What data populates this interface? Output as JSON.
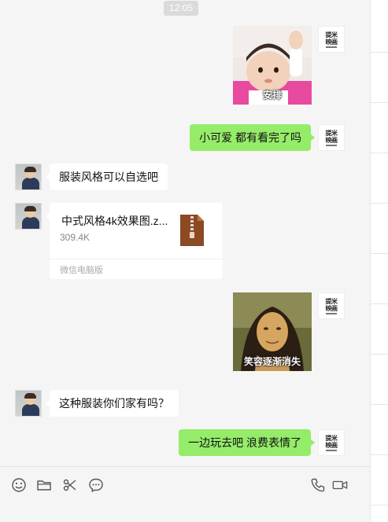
{
  "time_divider": "12:05",
  "brand_avatar": {
    "line1": "提米",
    "line2": "映画"
  },
  "messages": {
    "sticker1_caption": "安排",
    "msg1": "小可爱 都有看完了吗",
    "msg2": "服装风格可以自选吧",
    "file": {
      "name": "中式风格4k效果图.z...",
      "size": "309.4K",
      "source": "微信电脑版",
      "icon": "zip-file-icon"
    },
    "sticker2_caption": "笑容逐渐消失",
    "msg3": "这种服装你们家有吗？",
    "msg4": "一边玩去吧  浪费表情了"
  },
  "toolbar": {
    "icons": [
      "emoji-icon",
      "folder-icon",
      "scissors-icon",
      "chat-history-icon",
      "phone-icon",
      "video-call-icon"
    ]
  },
  "colors": {
    "self_bubble": "#95ec69",
    "other_bubble": "#ffffff",
    "background": "#f5f5f5",
    "zip_icon": "#8b4a24"
  }
}
